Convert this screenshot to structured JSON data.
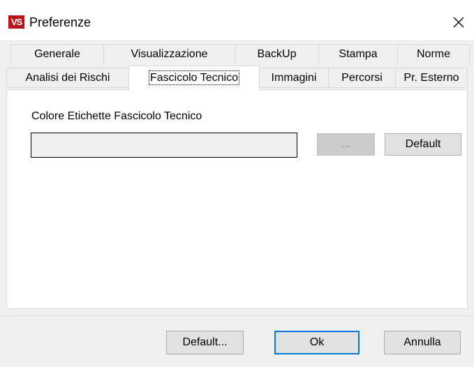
{
  "window": {
    "icon_label": "VS",
    "title": "Preferenze"
  },
  "tabs": {
    "row1": [
      {
        "label": "Generale"
      },
      {
        "label": "Visualizzazione"
      },
      {
        "label": "BackUp"
      },
      {
        "label": "Stampa"
      },
      {
        "label": "Norme"
      }
    ],
    "row2": [
      {
        "label": "Analisi dei Rischi"
      },
      {
        "label": "Fascicolo Tecnico",
        "active": true
      },
      {
        "label": "Immagini"
      },
      {
        "label": "Percorsi"
      },
      {
        "label": "Pr. Esterno"
      }
    ]
  },
  "panel": {
    "color_label": "Colore Etichette Fascicolo Tecnico",
    "color_value": "#f0f0f0",
    "browse_label": "...",
    "default_label": "Default"
  },
  "footer": {
    "default_label": "Default...",
    "ok_label": "Ok",
    "cancel_label": "Annulla"
  },
  "colors": {
    "accent": "#0078d7",
    "icon": "#b8141b"
  },
  "icons": {
    "close": "close-icon",
    "app": "app-icon"
  }
}
